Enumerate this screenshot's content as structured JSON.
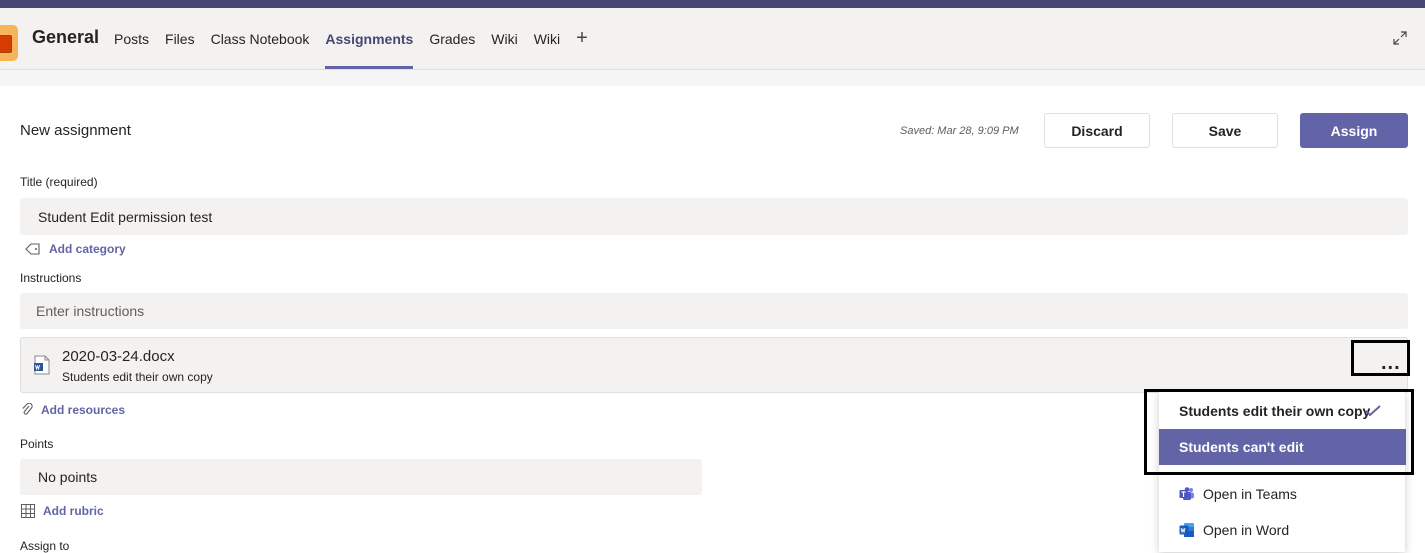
{
  "header": {
    "channel_name": "General",
    "tabs": [
      {
        "label": "Posts"
      },
      {
        "label": "Files"
      },
      {
        "label": "Class Notebook"
      },
      {
        "label": "Assignments",
        "active": true
      },
      {
        "label": "Grades"
      },
      {
        "label": "Wiki"
      },
      {
        "label": "Wiki"
      }
    ],
    "add_tab_label": "+"
  },
  "assignment": {
    "page_title": "New assignment",
    "saved_text": "Saved: Mar 28, 9:09 PM",
    "discard_label": "Discard",
    "save_label": "Save",
    "assign_label": "Assign",
    "title_label": "Title (required)",
    "title_value": "Student Edit permission test",
    "add_category_label": "Add category",
    "instructions_label": "Instructions",
    "instructions_placeholder": "Enter instructions",
    "attachment": {
      "file_name": "2020-03-24.docx",
      "permission": "Students edit their own copy",
      "more_label": "..."
    },
    "add_resources_label": "Add resources",
    "points_label": "Points",
    "points_value": "No points",
    "add_rubric_label": "Add rubric",
    "assign_to_label": "Assign to"
  },
  "context_menu": {
    "items": [
      {
        "label": "Students edit their own copy",
        "checked": true
      },
      {
        "label": "Students can't edit",
        "highlighted": true
      },
      {
        "label": "Open in Teams"
      },
      {
        "label": "Open in Word"
      }
    ]
  },
  "colors": {
    "accent": "#6264a7",
    "topbar": "#464775",
    "field_bg": "#f3f2f1"
  },
  "icons": {
    "expand": "expand-icon",
    "tag": "tag-icon",
    "word_doc": "word-doc-icon",
    "paperclip": "paperclip-icon",
    "grid": "grid-icon",
    "check": "checkmark-icon",
    "teams": "teams-icon",
    "word": "word-icon"
  }
}
